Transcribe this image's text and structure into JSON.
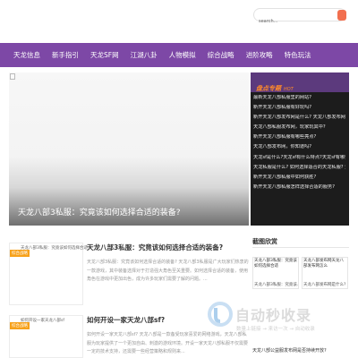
{
  "search": {
    "placeholder": "search..."
  },
  "nav": {
    "items": [
      "天龙信息",
      "新手指引",
      "天龙SF网",
      "江湖八卦",
      "人物模拟",
      "综合战略",
      "进阶攻略",
      "特色玩法"
    ]
  },
  "hero": {
    "caption": "天龙八部3私服：究竟该如何选择合适的装备?"
  },
  "hot": {
    "title": "盘点专题",
    "subtitle": "HOT",
    "items": [
      "最新天龙八部私服里的网站?",
      "新开天龙八部私服有好玩吗?",
      "新开天龙八部发布网是什么? 天龙八部发布网怎么",
      "天龙八部私服发布网，玩家玩其中?",
      "新开天龙八部私服有哪些亮点?",
      "天龙八部发布网，你知道吗?",
      "天龙sf是什么?天龙sf有什么特点?天龙sf有哪些游",
      "天龙私服是什么? 如何选择适合的天龙私服? 天龙",
      "新开天龙八部私服中如何获胜?",
      "新开天龙八部私服怎样选择合适的服务?"
    ]
  },
  "articles": [
    {
      "tag": "综合战略",
      "thumb_label": "天龙八部3私服：究竟该如何选择合适",
      "title": "天龙八部3私服：究竟该如何选择合适的装备?",
      "excerpt": "天龙八部3私服：究竟该如何选择合适的装备? 天龙八部3私服是广大玩家们热衷的一款游戏，其中装备选择对于打造强大角色至关重要。如何选择合适的装备，使用角色在游戏中更加出色，成为许多玩家们需要了解的问题。..."
    },
    {
      "tag": "综合战略",
      "thumb_label": "如何开设一家天龙八部sf",
      "title": "如何开设一家天龙八部sf?",
      "excerpt": "如何开设一家天龙八部sf? 天龙八部是一款备受玩家喜爱的网络游戏，天龙八部私服为玩家提供了一个更加自由、刺激的游戏环境。开设一家天龙八部私服不仅需要一定的技术支持，还需要一些经营策略和规则来..."
    }
  ],
  "side": {
    "title": "截图欣赏",
    "cards": [
      {
        "caption": "天龙八部3私服：究竟该如何选择合适",
        "sub": "天龙八部3私服：究竟该..."
      },
      {
        "caption": "天龙八部发布网天龙八部发布网怎么",
        "sub": "天龙八部发布网是什么?"
      }
    ],
    "footer": "天龙八部公益服发布网是否持续开放?"
  },
  "watermark": {
    "title": "自动秒收录",
    "subtitle": "数量上链接 → 来访一次 → 自动收录"
  }
}
